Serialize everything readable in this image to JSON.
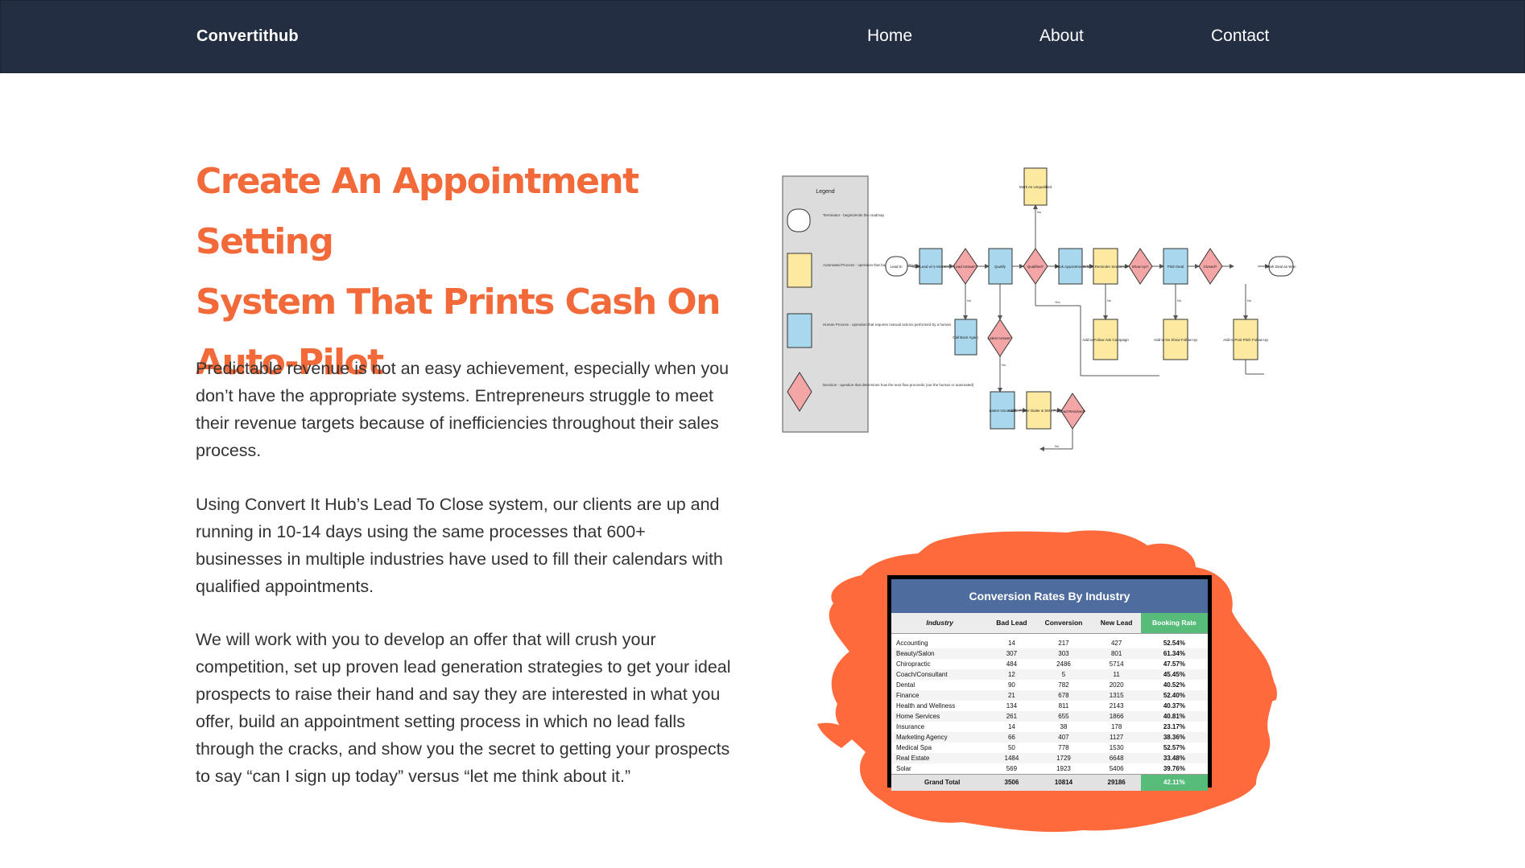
{
  "nav": {
    "brand": "Convertithub",
    "links": [
      {
        "label": "Home"
      },
      {
        "label": "About"
      },
      {
        "label": "Contact"
      }
    ]
  },
  "hero": {
    "headline_lines": [
      "Create An Appointment Setting",
      "System That Prints Cash On",
      "Auto-Pilot"
    ],
    "paragraphs": [
      "Predictable revenue is not an easy achievement, especially when you don’t have the appropriate systems. Entrepreneurs struggle to meet their revenue targets because of inefficiencies throughout their sales process.",
      "Using Convert It Hub’s Lead To Close system, our clients are up and running in 10-14 days using the same processes that 600+ businesses in multiple industries have used to fill their calendars with qualified appointments.",
      "We will work with you to develop an offer that will crush your competition, set up proven lead generation strategies to get your ideal prospects to raise their hand and say they are interested in what you offer, build an appointment setting process in which no lead falls through the cracks, and show you the secret to getting your prospects to say “can I sign up today” versus “let me think about it.”"
    ]
  },
  "flowchart": {
    "legend": {
      "title": "Legend",
      "items": [
        {
          "shape": "Start / Stop Flow",
          "desc": "Terminator - begins/ends the roadmap"
        },
        {
          "shape": "Automated Process",
          "desc": "Automated Process - operation that happens depending on position stage"
        },
        {
          "shape": "Human Process",
          "desc": "Human Process - operation that requires manual actions performed by a human"
        },
        {
          "shape": "Decision",
          "desc": "Decision - question that determines how the next flow proceeds (our the human or automated)"
        }
      ]
    },
    "nodes": {
      "lead_in": "Lead In",
      "call_lead": "Call Lead w/ 5 Minutes",
      "lead_answer": "Lead Answer?",
      "qualify": "Qualify",
      "qualified": "Qualified?",
      "book_appt": "Book Appointment",
      "add_reminder": "Add to Reminder Sequence",
      "show_up": "Show Up?",
      "pitch_deal": "Pitch Deal",
      "closed": "Closed?",
      "mark_won": "Mark Deal as Won",
      "mark_unqualified": "Mark As Unqualified",
      "call_back": "Call Back Again",
      "latest_answer": "Latest Answer?",
      "add_follow_up": "Add to Follow Ads Campaign",
      "no_show": "Add to No Show Follow Up",
      "post_pitch": "Add to Post Pitch Follow Up",
      "latest_voicemail": "Latest Voicemail",
      "power_dialer": "Add to Power Dialer & SMS Follow Up",
      "lead_resolved": "Lead Resolved?"
    },
    "edge_labels": {
      "yes": "Yes",
      "no": "No"
    }
  },
  "rates_table": {
    "title": "Conversion Rates By Industry",
    "columns": [
      "Industry",
      "Bad Lead",
      "Conversion",
      "New Lead",
      "Booking Rate"
    ],
    "rows": [
      [
        "Accounting",
        "14",
        "217",
        "427",
        "52.54%"
      ],
      [
        "Beauty/Salon",
        "307",
        "303",
        "801",
        "61.34%"
      ],
      [
        "Chiropractic",
        "484",
        "2486",
        "5714",
        "47.57%"
      ],
      [
        "Coach/Consultant",
        "12",
        "5",
        "11",
        "45.45%"
      ],
      [
        "Dental",
        "90",
        "782",
        "2020",
        "40.52%"
      ],
      [
        "Finance",
        "21",
        "678",
        "1315",
        "52.40%"
      ],
      [
        "Health and Wellness",
        "134",
        "811",
        "2143",
        "40.37%"
      ],
      [
        "Home Services",
        "261",
        "655",
        "1866",
        "40.81%"
      ],
      [
        "Insurance",
        "14",
        "38",
        "178",
        "23.17%"
      ],
      [
        "Marketing Agency",
        "66",
        "407",
        "1127",
        "38.36%"
      ],
      [
        "Medical Spa",
        "50",
        "778",
        "1530",
        "52.57%"
      ],
      [
        "Real Estate",
        "1484",
        "1729",
        "6648",
        "33.48%"
      ],
      [
        "Solar",
        "569",
        "1923",
        "5406",
        "39.76%"
      ]
    ],
    "total": [
      "Grand Total",
      "3506",
      "10814",
      "29186",
      "42.11%"
    ]
  },
  "colors": {
    "nav_bg": "#242e42",
    "accent": "#f36a3a",
    "table_header": "#4f6c9e",
    "booking_green": "#57bb7a",
    "splash": "#ff6a3d"
  }
}
